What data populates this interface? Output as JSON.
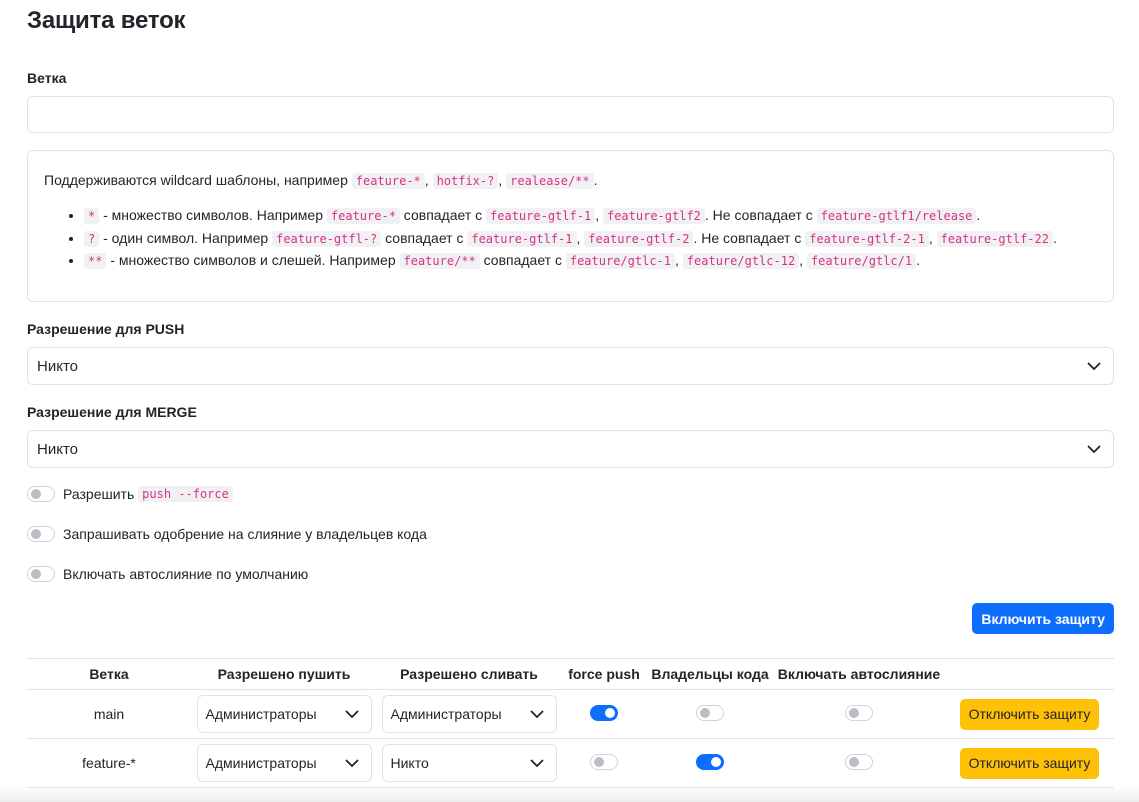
{
  "page": {
    "title": "Защита веток"
  },
  "branch_field": {
    "label": "Ветка",
    "value": "",
    "placeholder": ""
  },
  "hint": {
    "intro_prefix": "Поддерживаются wildcard шаблоны, например",
    "intro_examples": [
      "feature-*",
      "hotfix-?",
      "realease/**"
    ],
    "rules": [
      {
        "pattern": "*",
        "description": " - множество символов. Например ",
        "example": "feature-*",
        "matches_label": " совпадает с ",
        "matches": [
          "feature-gtlf-1",
          "feature-gtlf2"
        ],
        "non_match_label": ". Не совпадает с ",
        "non_matches": [
          "feature-gtlf1/release"
        ]
      },
      {
        "pattern": "?",
        "description": " - один символ. Например ",
        "example": "feature-gtfl-?",
        "matches_label": " совпадает с ",
        "matches": [
          "feature-gtlf-1",
          "feature-gtlf-2"
        ],
        "non_match_label": ". Не совпадает с ",
        "non_matches": [
          "feature-gtlf-2-1",
          "feature-gtlf-22"
        ]
      },
      {
        "pattern": "**",
        "description": " - множество символов и слешей. Например ",
        "example": "feature/**",
        "matches_label": " совпадает с ",
        "matches": [
          "feature/gtlc-1",
          "feature/gtlc-12",
          "feature/gtlc/1"
        ],
        "non_match_label": "",
        "non_matches": []
      }
    ]
  },
  "push_permission": {
    "label": "Разрешение для PUSH",
    "value": "Никто"
  },
  "merge_permission": {
    "label": "Разрешение для MERGE",
    "value": "Никто"
  },
  "switches": {
    "force_push": {
      "label": "Разрешить",
      "code": "push --force",
      "on": false
    },
    "code_owners": {
      "label": "Запрашивать одобрение на слияние у владельцев кода",
      "on": false
    },
    "auto_merge": {
      "label": "Включать автослияние по умолчанию",
      "on": false
    }
  },
  "enable_button": {
    "label": "Включить защиту"
  },
  "table": {
    "headers": [
      "Ветка",
      "Разрешено пушить",
      "Разрешено сливать",
      "force push",
      "Владельцы кода",
      "Включать автослияние",
      ""
    ],
    "rows": [
      {
        "branch": "main",
        "push": "Администраторы",
        "merge": "Администраторы",
        "force_push": true,
        "code_owners": false,
        "auto_merge": false,
        "action": "Отключить защиту"
      },
      {
        "branch": "feature-*",
        "push": "Администраторы",
        "merge": "Никто",
        "force_push": false,
        "code_owners": true,
        "auto_merge": false,
        "action": "Отключить защиту"
      }
    ]
  },
  "colors": {
    "primary": "#0d6efd",
    "warning": "#ffc107",
    "code": "#d63384",
    "border": "#dee2e6"
  },
  "icons": {
    "select": "chevron-down-icon"
  }
}
